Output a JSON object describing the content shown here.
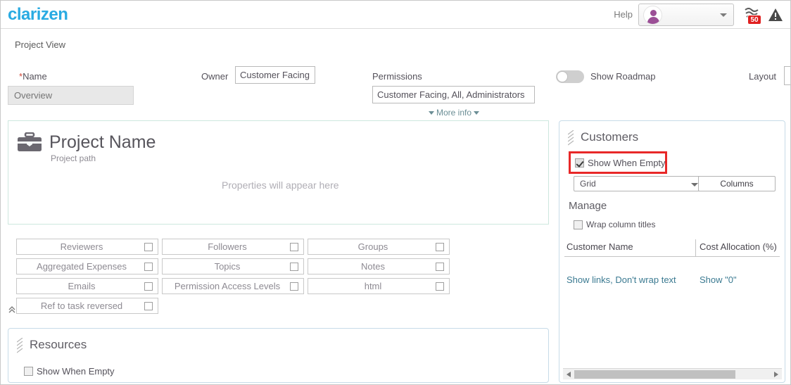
{
  "topbar": {
    "logo": "clarizen",
    "help": "Help",
    "notification_count": "50",
    "icons": {
      "user": "user-avatar-icon",
      "dropdown": "chevron-down-icon",
      "notifications": "notifications-waves-icon",
      "warning": "warning-triangle-icon"
    }
  },
  "breadcrumb": "Project View",
  "form": {
    "name_label_star": "*",
    "name_label": "Name",
    "name_placeholder": "Overview",
    "name_value": "",
    "owner_label": "Owner",
    "owner_value": "Customer Facing",
    "permissions_label": "Permissions",
    "permissions_value": "Customer Facing, All, Administrators",
    "more_info": "More info",
    "show_roadmap_label": "Show Roadmap",
    "show_roadmap_on": false,
    "layout_label": "Layout",
    "layout_value": ""
  },
  "hero": {
    "icon": "briefcase-icon",
    "project_name": "Project Name",
    "project_path": "Project path",
    "properties_hint": "Properties will appear here"
  },
  "checkbox_grid": {
    "rows": [
      [
        {
          "label": "Reviewers",
          "checked": false
        },
        {
          "label": "Followers",
          "checked": false
        },
        {
          "label": "Groups",
          "checked": false
        }
      ],
      [
        {
          "label": "Aggregated Expenses",
          "checked": false
        },
        {
          "label": "Topics",
          "checked": false
        },
        {
          "label": "Notes",
          "checked": false
        }
      ],
      [
        {
          "label": "Emails",
          "checked": false
        },
        {
          "label": "Permission Access Levels",
          "checked": false
        },
        {
          "label": "html",
          "checked": false
        }
      ],
      [
        {
          "label": "Ref to task reversed",
          "checked": false
        }
      ]
    ]
  },
  "resources_panel": {
    "title": "Resources",
    "show_when_empty_label": "Show When Empty",
    "show_when_empty_checked": false
  },
  "customers_panel": {
    "title": "Customers",
    "show_when_empty_label": "Show When Empty",
    "show_when_empty_checked": true,
    "highlight_color": "#e82828",
    "view_select_value": "Grid",
    "columns_button": "Columns",
    "manage_title": "Manage",
    "wrap_column_titles_label": "Wrap column titles",
    "wrap_column_titles_checked": false,
    "table": {
      "headers": [
        "Customer Name",
        "Cost Allocation (%)"
      ],
      "rows": [
        [
          "Show links, Don't wrap text",
          "Show \"0\""
        ]
      ]
    }
  },
  "colors": {
    "brand": "#29abe2",
    "link": "#3b7a91",
    "badge": "#e02020",
    "highlight": "#e82828",
    "hero_border": "#cde7de",
    "panel_border": "#c7dbe8"
  }
}
